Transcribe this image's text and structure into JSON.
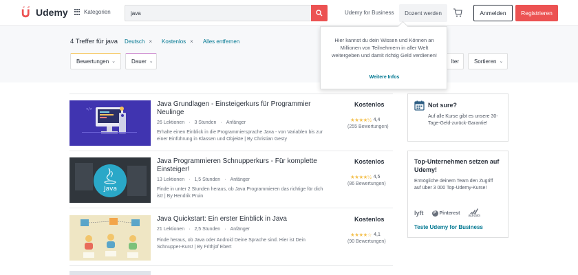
{
  "header": {
    "logo_text": "Udemy",
    "categories_label": "Kategorien",
    "search_value": "java",
    "business_label": "Udemy for Business",
    "teach_label": "Dozent werden",
    "login_label": "Anmelden",
    "signup_label": "Registrieren"
  },
  "filters": {
    "results_text": "4 Treffer für java",
    "chips": [
      {
        "label": "Deutsch",
        "remove": "×"
      },
      {
        "label": "Kostenlos",
        "remove": "×"
      }
    ],
    "clear_all": "Alles entfernen",
    "rating_label": "Bewertungen",
    "duration_label": "Dauer",
    "filter_label": "lter",
    "sort_label": "Sortieren"
  },
  "popover": {
    "text": "Hier kannst du dein Wissen und Können an Millionen von Teilnehmern in aller Welt weitergeben und damit richtig Geld verdienen!",
    "link": "Weitere Infos"
  },
  "courses": [
    {
      "title": "Java Grundlagen - Einsteigerkurs für Programmier Neulinge",
      "lectures": "26 Lektionen",
      "hours": "3 Stunden",
      "level": "Anfänger",
      "description": "Erhalte einen Einblick in die Programmiersprache Java - von Variablen bis zur einer Einführung in Klassen und Objekte | By Christian Gesty",
      "price": "Kostenlos",
      "rating": "4,4",
      "reviews": "(255 Bewertungen)",
      "stars": "★★★★½"
    },
    {
      "title": "Java Programmieren Schnupperkurs - Für komplette Einsteiger!",
      "lectures": "13 Lektionen",
      "hours": "1,5 Stunden",
      "level": "Anfänger",
      "description": "Finde in unter 2 Stunden heraus, ob Java Programmieren das richtige für dich ist! | By Hendrik Pruin",
      "price": "Kostenlos",
      "rating": "4,5",
      "reviews": "(86 Bewertungen)",
      "stars": "★★★★½",
      "thumb_label": "Java"
    },
    {
      "title": "Java Quickstart: Ein erster Einblick in Java",
      "lectures": "21 Lektionen",
      "hours": "2,5 Stunden",
      "level": "Anfänger",
      "description": "Finde heraus, ob Java oder Android Deine Sprache sind. Hier ist Dein Schnupper-Kurs! | By Frithjof Ebert",
      "price": "Kostenlos",
      "rating": "4,1",
      "reviews": "(90 Bewertungen)",
      "stars": "★★★★☆"
    }
  ],
  "sidebar": {
    "not_sure_title": "Not sure?",
    "not_sure_text": "Auf alle Kurse gibt es unsere 30-Tage-Geld-zurück-Garantie!",
    "top_title": "Top-Unternehmen setzen auf Udemy!",
    "top_text": "Ermögliche deinem Team den Zugriff auf über 3 000 Top-Udemy-Kurse!",
    "logo_lyft": "lyft",
    "logo_pinterest": "Pinterest",
    "logo_adidas": "adidas",
    "top_link": "Teste Udemy for Business"
  },
  "colors": {
    "brand_red": "#ec5252",
    "link_teal": "#007791",
    "star_yellow": "#f4c150"
  }
}
